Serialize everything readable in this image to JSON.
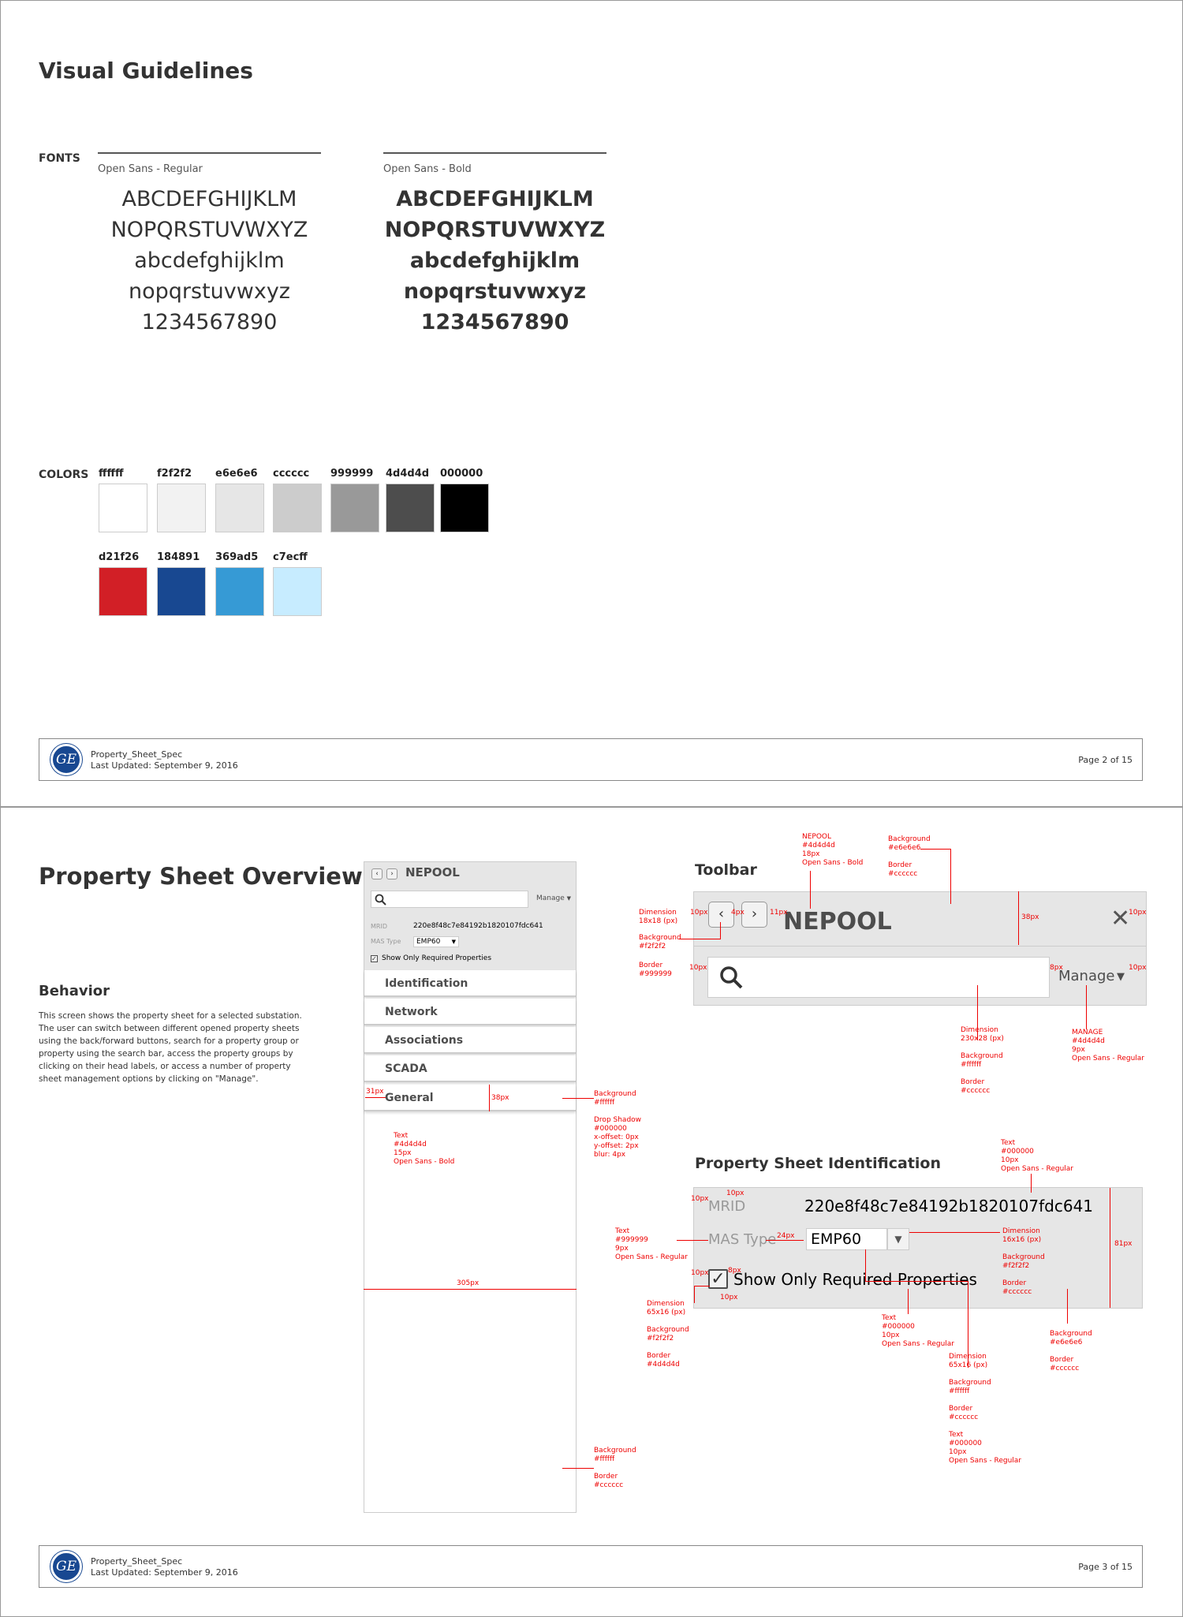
{
  "page1": {
    "title": "Visual Guidelines",
    "fonts_label": "FONTS",
    "fonts": [
      {
        "name": "Open Sans - Regular",
        "lines": [
          "ABCDEFGHIJKLM",
          "NOPQRSTUVWXYZ",
          "abcdefghijklm",
          "nopqrstuvwxyz",
          "1234567890"
        ]
      },
      {
        "name": "Open Sans - Bold",
        "lines": [
          "ABCDEFGHIJKLM",
          "NOPQRSTUVWXYZ",
          "abcdefghijklm",
          "nopqrstuvwxyz",
          "1234567890"
        ]
      }
    ],
    "colors_label": "COLORS",
    "colors_row1": [
      {
        "label": "ffffff",
        "hex": "#ffffff"
      },
      {
        "label": "f2f2f2",
        "hex": "#f2f2f2"
      },
      {
        "label": "e6e6e6",
        "hex": "#e6e6e6"
      },
      {
        "label": "cccccc",
        "hex": "#cccccc"
      },
      {
        "label": "999999",
        "hex": "#999999"
      },
      {
        "label": "4d4d4d",
        "hex": "#4d4d4d"
      },
      {
        "label": "000000",
        "hex": "#000000"
      }
    ],
    "colors_row2": [
      {
        "label": "d21f26",
        "hex": "#d21f26"
      },
      {
        "label": "184891",
        "hex": "#184891"
      },
      {
        "label": "369ad5",
        "hex": "#369ad5"
      },
      {
        "label": "c7ecff",
        "hex": "#c7ecff"
      }
    ],
    "footer": {
      "logo": "GE",
      "name": "Property_Sheet_Spec",
      "date": "Last Updated: September 9, 2016",
      "page": "Page 2 of 15"
    }
  },
  "page2": {
    "title": "Property Sheet Overview",
    "behavior_title": "Behavior",
    "behavior_text": "This screen shows the property sheet for a selected substation. The user can switch between different opened property sheets using the back/forward buttons, search for a property group or property using the search bar, access the property groups by clicking on their head labels, or access a number of property sheet management options by clicking on \"Manage\".",
    "panel": {
      "back": "‹",
      "forward": "›",
      "title": "NEPOOL",
      "manage": "Manage",
      "caret": "▼",
      "mrid_key": "MRID",
      "mrid_val": "220e8f48c7e84192b1820107fdc641",
      "mas_key": "MAS Type",
      "mas_val": "EMP60",
      "check": "✓",
      "check_label": "Show Only Required Properties",
      "groups": [
        "Identification",
        "Network",
        "Associations",
        "SCADA",
        "General"
      ]
    },
    "toolbar": {
      "heading": "Toolbar",
      "back": "‹",
      "forward": "›",
      "title": "NEPOOL",
      "close": "✕",
      "manage": "Manage",
      "caret": "▼"
    },
    "identification": {
      "heading": "Property Sheet Identification",
      "mrid_key": "MRID",
      "mrid_val": "220e8f48c7e84192b1820107fdc641",
      "mas_key": "MAS Type",
      "mas_val": "EMP60",
      "caret": "▼",
      "check": "✓",
      "check_label": "Show Only Required Properties"
    },
    "annotations": {
      "nepool": "NEPOOL\n#4d4d4d\n18px\nOpen Sans - Bold",
      "tb_bg": "Background\n#e6e6e6\n\nBorder\n#cccccc",
      "dim18": "Dimension\n18x18 (px)",
      "bg_f2": "Background\n#f2f2f2",
      "border_999": "Border\n#999999",
      "px10a": "10px",
      "px4": "4px",
      "px11": "11px",
      "px10b": "10px",
      "px38": "38px",
      "px10c": "10px",
      "px8": "8px",
      "px10d": "10px",
      "search_dim": "Dimension\n230x28 (px)\n\nBackground\n#ffffff\n\nBorder\n#cccccc",
      "manage_spec": "MANAGE\n#4d4d4d\n9px\nOpen Sans - Regular",
      "px31": "31px",
      "px38b": "38px",
      "grp_bg": "Background\n#ffffff\n\nDrop Shadow\n#000000\nx-offset: 0px\ny-offset: 2px\nblur: 4px",
      "grp_text": "Text\n#4d4d4d\n15px\nOpen Sans - Bold",
      "px305": "305px",
      "panel_bg": "Background\n#ffffff\n\nBorder\n#cccccc",
      "mrid_text": "Text\n#000000\n10px\nOpen Sans - Regular",
      "px10e": "10px",
      "px10f": "10px",
      "key_text": "Text\n#999999\n9px\nOpen Sans - Regular",
      "px24": "24px",
      "caret_dim": "Dimension\n16x16 (px)\n\nBackground\n#f2f2f2\n\nBorder\n#cccccc",
      "px81": "81px",
      "px10g": "10px",
      "px8b": "8px",
      "px10h": "10px",
      "chk_dim": "Dimension\n65x16 (px)\n\nBackground\n#f2f2f2\n\nBorder\n#4d4d4d",
      "chk_text": "Text\n#000000\n10px\nOpen Sans - Regular",
      "id_bg": "Background\n#e6e6e6\n\nBorder\n#cccccc",
      "sel_dim": "Dimension\n65x16 (px)\n\nBackground\n#ffffff\n\nBorder\n#cccccc\n\nText\n#000000\n10px\nOpen Sans - Regular"
    },
    "footer": {
      "logo": "GE",
      "name": "Property_Sheet_Spec",
      "date": "Last Updated: September 9, 2016",
      "page": "Page 3 of 15"
    }
  }
}
